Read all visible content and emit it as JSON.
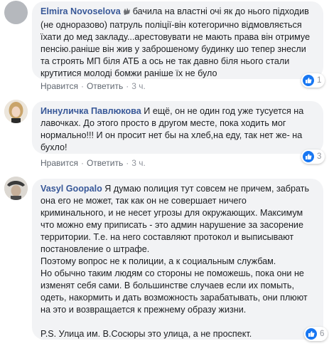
{
  "comments": [
    {
      "author": "Elmira Novoselova",
      "lines": [
        "бачила на властні очі як до нього підходив",
        "(не одноразово) патруль поліції-він котегорично відмовляється",
        "їхати до мед закладу...арестовувати не мають права він отримуе",
        "пенсію.раніше він жив у заброшеному будинку шо тепер знесли",
        "та строять МП біля АТБ а ось не так давно біля нього стали",
        "крутитися молоді бомжи раніше їх не було"
      ],
      "like_label": "Нравится",
      "reply_label": "Ответить",
      "time": "3 ч.",
      "reaction_count": "1"
    },
    {
      "author": "Иннуличка Павлюкова",
      "lines": [
        "И ещё, он не один год уже тусуется на",
        "лавочках. До этого просто в другом месте, пока ходить мог",
        "нормально!!! И он просит нет бы на хлеб,на еду, так нет же- на",
        "бухло!"
      ],
      "like_label": "Нравится",
      "reply_label": "Ответить",
      "time": "3 ч.",
      "reaction_count": "3"
    },
    {
      "author": "Vasyl Goopalo",
      "lines": [
        "Я думаю полиция тут совсем не причем, забрать",
        "она его не может, так как он не совершает ничего",
        "криминального, и не несет угрозы для окружающих. Максимум",
        "что можно ему приписать - это админ нарушение за засорение",
        "территории. Т.е. на него составляют протокол и выписывают",
        "постановление о штрафе.",
        "Поэтому вопрос не к полиции, а к социальным службам.",
        "Но обычно таким людям со стороны не поможешь, пока они не",
        "изменят себя сами. В большинстве случаев если их помыть,",
        "одеть, накормить и дать возможность зарабатывать, они плюют",
        "на это и возвращается к прежнему образу жизни.",
        "",
        "P.S. Улица им. В.Сосюры это улица, а не проспект."
      ],
      "like_label": "Нравится",
      "reply_label": "Ответить",
      "time": "3 ч.",
      "reaction_count": "6"
    }
  ],
  "colors": {
    "author": "#385898",
    "bubble": "#f2f3f5",
    "like": "#1877f2",
    "meta": "#90949c"
  },
  "icons": {
    "verified": "verified-badge-icon",
    "like": "thumbs-up-icon"
  }
}
